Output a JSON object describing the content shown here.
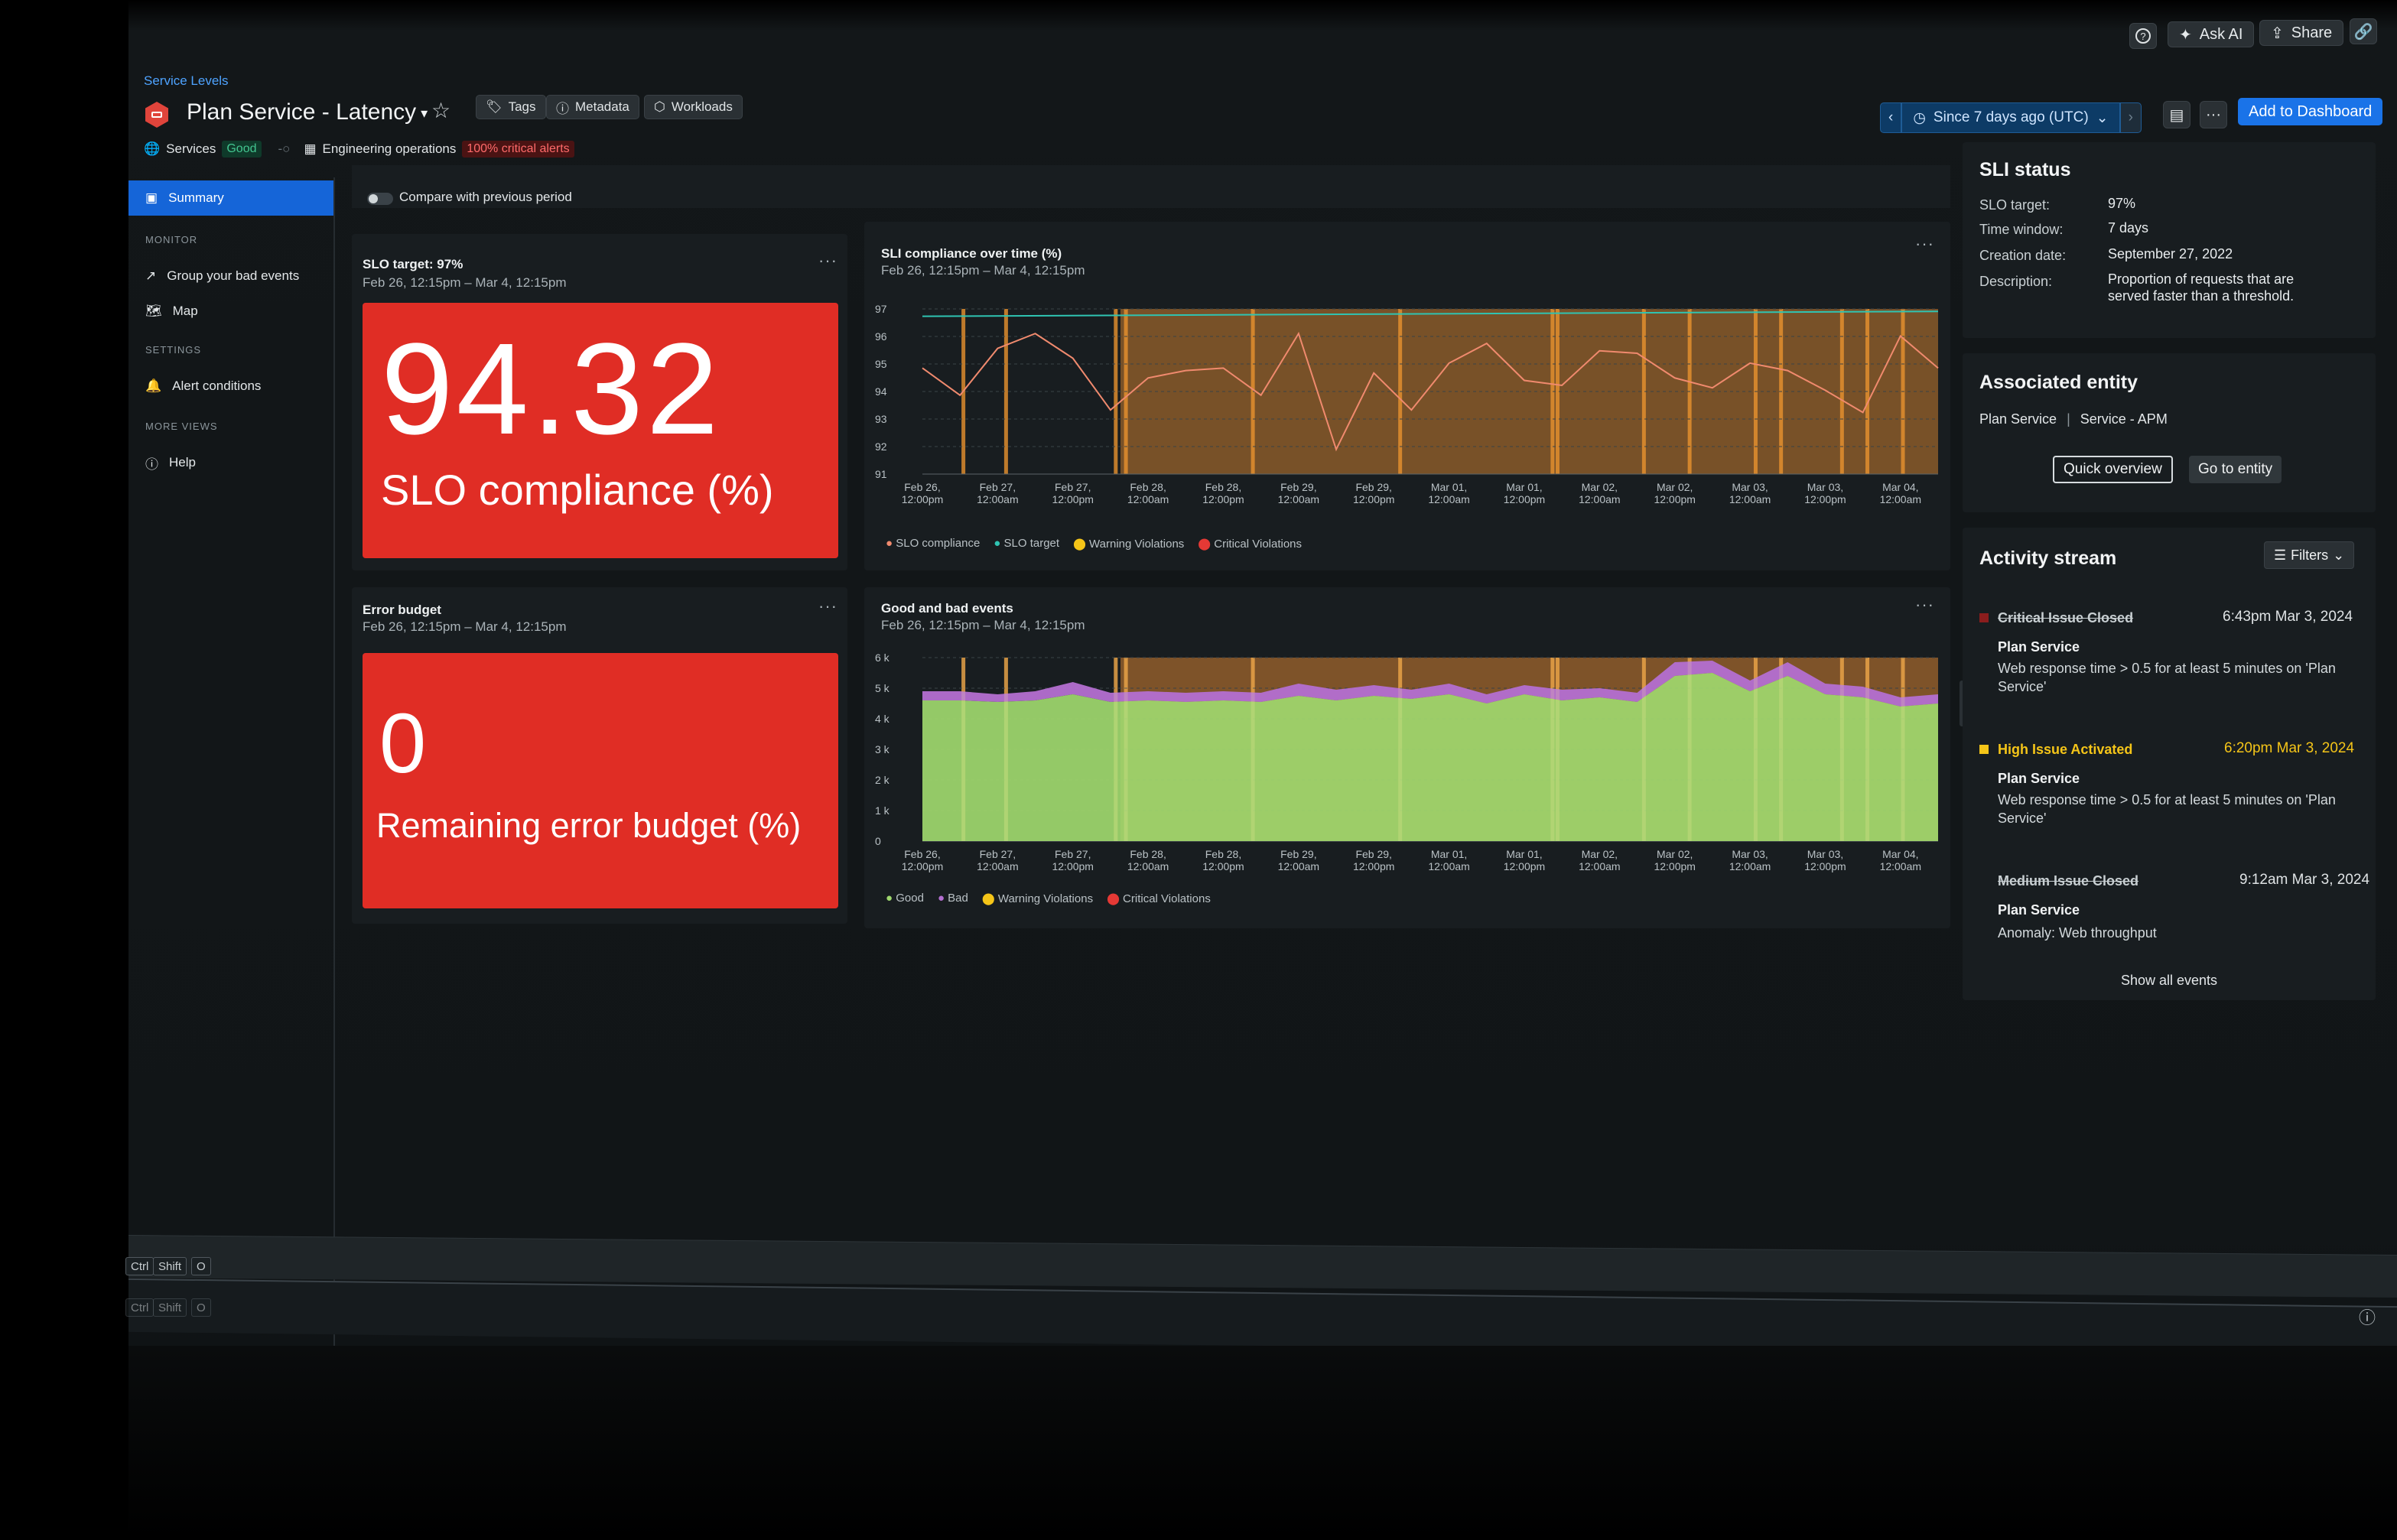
{
  "topbar": {
    "ask_ai": "Ask AI",
    "share": "Share"
  },
  "header": {
    "breadcrumb": "Service Levels",
    "title": "Plan Service - Latency",
    "chips": [
      "Tags",
      "Metadata",
      "Workloads"
    ],
    "services_label": "Services",
    "services_status": "Good",
    "team_label": "Engineering operations",
    "alerts_badge": "100% critical alerts"
  },
  "time_picker": {
    "label": "Since 7 days ago (UTC)"
  },
  "add_dashboard": "Add to Dashboard",
  "nav": {
    "summary": "Summary",
    "monitor_title": "MONITOR",
    "group_bad_events": "Group your bad events",
    "map": "Map",
    "settings_title": "SETTINGS",
    "alert_conditions": "Alert conditions",
    "more_views_title": "MORE VIEWS",
    "help": "Help"
  },
  "compare_label": "Compare with previous period",
  "slo_panel": {
    "title": "SLO target: 97%",
    "range": "Feb 26, 12:15pm – Mar 4, 12:15pm",
    "value": "94.32",
    "caption": "SLO compliance (%)"
  },
  "error_panel": {
    "title": "Error budget",
    "range": "Feb 26, 12:15pm – Mar 4, 12:15pm",
    "value": "0",
    "caption": "Remaining error budget (%)"
  },
  "sli_chart": {
    "title": "SLI compliance over time (%)",
    "range": "Feb 26, 12:15pm – Mar 4, 12:15pm",
    "legend": [
      "SLO compliance",
      "SLO target",
      "Warning Violations",
      "Critical Violations"
    ]
  },
  "events_chart": {
    "title": "Good and bad events",
    "range": "Feb 26, 12:15pm – Mar 4, 12:15pm",
    "legend": [
      "Good",
      "Bad",
      "Warning Violations",
      "Critical Violations"
    ]
  },
  "chart_data": [
    {
      "type": "line",
      "title": "SLI compliance over time (%)",
      "x_ticks": [
        [
          "Feb 26,",
          "12:00pm"
        ],
        [
          "Feb 27,",
          "12:00am"
        ],
        [
          "Feb 27,",
          "12:00pm"
        ],
        [
          "Feb 28,",
          "12:00am"
        ],
        [
          "Feb 28,",
          "12:00pm"
        ],
        [
          "Feb 29,",
          "12:00am"
        ],
        [
          "Feb 29,",
          "12:00pm"
        ],
        [
          "Mar 01,",
          "12:00am"
        ],
        [
          "Mar 01,",
          "12:00pm"
        ],
        [
          "Mar 02,",
          "12:00am"
        ],
        [
          "Mar 02,",
          "12:00pm"
        ],
        [
          "Mar 03,",
          "12:00am"
        ],
        [
          "Mar 03,",
          "12:00pm"
        ],
        [
          "Mar 04,",
          "12:00am"
        ]
      ],
      "y_ticks": [
        97,
        96,
        95,
        94,
        93,
        92,
        91
      ],
      "ylim": [
        90.6,
        97.3
      ],
      "series": [
        {
          "name": "SLO compliance",
          "color": "#f08a6e",
          "values": [
            94.9,
            93.8,
            95.7,
            96.3,
            95.3,
            93.2,
            94.5,
            94.8,
            94.9,
            93.8,
            96.3,
            91.6,
            94.7,
            93.2,
            95.1,
            95.9,
            94.4,
            94.2,
            95.6,
            95.5,
            94.5,
            94.1,
            95.1,
            94.8,
            94.0,
            93.1,
            96.2,
            94.9
          ]
        },
        {
          "name": "SLO target",
          "color": "#2fc4b2",
          "values": [
            97,
            97.2
          ]
        }
      ],
      "grid": true
    },
    {
      "type": "area",
      "title": "Good and bad events",
      "x_ticks": [
        [
          "Feb 26,",
          "12:00pm"
        ],
        [
          "Feb 27,",
          "12:00am"
        ],
        [
          "Feb 27,",
          "12:00pm"
        ],
        [
          "Feb 28,",
          "12:00am"
        ],
        [
          "Feb 28,",
          "12:00pm"
        ],
        [
          "Feb 29,",
          "12:00am"
        ],
        [
          "Feb 29,",
          "12:00pm"
        ],
        [
          "Mar 01,",
          "12:00am"
        ],
        [
          "Mar 01,",
          "12:00pm"
        ],
        [
          "Mar 02,",
          "12:00am"
        ],
        [
          "Mar 02,",
          "12:00pm"
        ],
        [
          "Mar 03,",
          "12:00am"
        ],
        [
          "Mar 03,",
          "12:00pm"
        ],
        [
          "Mar 04,",
          "12:00am"
        ]
      ],
      "y_ticks": [
        "6 k",
        "5 k",
        "4 k",
        "3 k",
        "2 k",
        "1 k",
        "0"
      ],
      "ylim": [
        0,
        6000
      ],
      "series": [
        {
          "name": "Good",
          "color": "#9fd86e",
          "values": [
            4600,
            4600,
            4550,
            4600,
            4800,
            4550,
            4600,
            4550,
            4600,
            4550,
            4750,
            4600,
            4750,
            4650,
            4800,
            4500,
            4800,
            4600,
            4700,
            4550,
            5400,
            5500,
            4900,
            5400,
            4800,
            4700,
            4400,
            4500
          ]
        },
        {
          "name": "Bad",
          "color": "#b46fd1",
          "values": [
            300,
            300,
            250,
            300,
            400,
            300,
            300,
            300,
            300,
            300,
            400,
            350,
            350,
            300,
            350,
            300,
            300,
            350,
            300,
            300,
            450,
            400,
            350,
            450,
            350,
            350,
            300,
            300
          ]
        }
      ],
      "grid": true
    }
  ],
  "sli_status": {
    "title": "SLI status",
    "rows": [
      {
        "label": "SLO target:",
        "value": "97%"
      },
      {
        "label": "Time window:",
        "value": "7 days"
      },
      {
        "label": "Creation date:",
        "value": "September 27, 2022"
      },
      {
        "label": "Description:",
        "value": "Proportion of requests that are served faster than a threshold."
      }
    ]
  },
  "entity": {
    "title": "Associated entity",
    "name": "Plan Service",
    "type": "Service - APM",
    "quick_overview": "Quick overview",
    "go_to_entity": "Go to entity"
  },
  "activity": {
    "title": "Activity stream",
    "filters": "Filters",
    "events": [
      {
        "title": "Critical Issue Closed",
        "time": "6:43pm Mar 3, 2024",
        "service": "Plan Service",
        "desc": "Web response time > 0.5 for at least 5 minutes on 'Plan Service'"
      },
      {
        "title": "High Issue Activated",
        "time": "6:20pm Mar 3, 2024",
        "service": "Plan Service",
        "desc": "Web response time > 0.5 for at least 5 minutes on 'Plan Service'"
      },
      {
        "title": "Medium Issue Closed",
        "time": "9:12am Mar 3, 2024",
        "service": "Plan Service",
        "desc": "Anomaly: Web throughput"
      }
    ],
    "show_all": "Show all events"
  },
  "shortcut": {
    "k1": "Ctrl",
    "k2": "Shift",
    "k3": "O"
  }
}
